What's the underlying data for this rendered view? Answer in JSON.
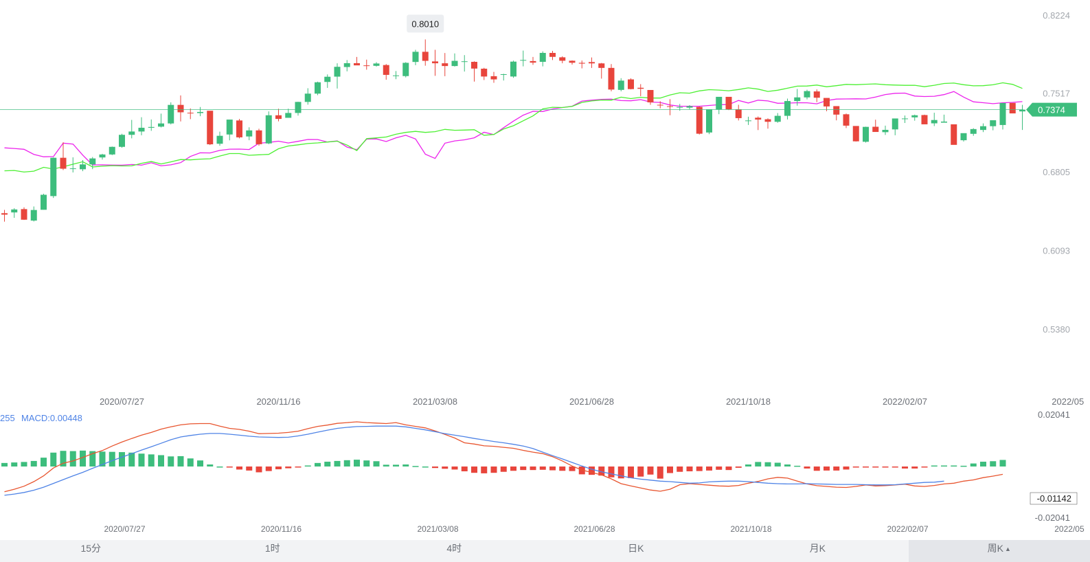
{
  "chart_data": [
    {
      "type": "candlestick",
      "title": "",
      "ylim": [
        0.538,
        0.8224
      ],
      "y_ticks": [
        "0.8224",
        "0.7517",
        "0.6805",
        "0.6093",
        "0.5380"
      ],
      "x_tick_labels": [
        "2020/07/27",
        "2020/11/16",
        "2021/03/08",
        "2021/06/28",
        "2021/10/18",
        "2022/02/07",
        "2022/05"
      ],
      "x_tick_index": [
        12,
        28,
        44,
        60,
        76,
        92,
        107
      ],
      "current_price": "0.7374",
      "max_label": "0.8010",
      "colors": {
        "up": "#3dbd7d",
        "down": "#e8453c",
        "upper_band": "#ec23ec",
        "lower_band": "#4cf032",
        "price_line": "#3dbd7d"
      },
      "candles": [
        [
          0.6436,
          0.6466,
          0.6423,
          0.6359
        ],
        [
          0.6443,
          0.6481,
          0.647,
          0.6394
        ],
        [
          0.6473,
          0.6489,
          0.6377,
          0.6375
        ],
        [
          0.6369,
          0.6497,
          0.6465,
          0.6361
        ],
        [
          0.6467,
          0.6612,
          0.6603,
          0.6468
        ],
        [
          0.6591,
          0.6941,
          0.6938,
          0.6574
        ],
        [
          0.6938,
          0.7078,
          0.6839,
          0.6827
        ],
        [
          0.684,
          0.6942,
          0.6842,
          0.6805
        ],
        [
          0.6834,
          0.6917,
          0.6878,
          0.6817
        ],
        [
          0.6878,
          0.6945,
          0.6932,
          0.6835
        ],
        [
          0.6941,
          0.6974,
          0.6968,
          0.6922
        ],
        [
          0.6968,
          0.704,
          0.7037,
          0.6962
        ],
        [
          0.7037,
          0.7155,
          0.7146,
          0.7029
        ],
        [
          0.7146,
          0.7281,
          0.7176,
          0.7114
        ],
        [
          0.7176,
          0.7305,
          0.721,
          0.7142
        ],
        [
          0.721,
          0.7285,
          0.7217,
          0.7182
        ],
        [
          0.722,
          0.7338,
          0.7249,
          0.7213
        ],
        [
          0.7249,
          0.744,
          0.7417,
          0.724
        ],
        [
          0.7417,
          0.7503,
          0.735,
          0.7267
        ],
        [
          0.7346,
          0.7385,
          0.7343,
          0.7288
        ],
        [
          0.7343,
          0.7398,
          0.7353,
          0.7315
        ],
        [
          0.7364,
          0.7343,
          0.706,
          0.7053
        ],
        [
          0.7065,
          0.7175,
          0.7137,
          0.7047
        ],
        [
          0.7149,
          0.728,
          0.7284,
          0.7096
        ],
        [
          0.7276,
          0.729,
          0.7123,
          0.7114
        ],
        [
          0.7131,
          0.7214,
          0.7186,
          0.7097
        ],
        [
          0.7186,
          0.7201,
          0.7061,
          0.7048
        ],
        [
          0.7068,
          0.7358,
          0.7323,
          0.7061
        ],
        [
          0.7323,
          0.7382,
          0.729,
          0.7268
        ],
        [
          0.73,
          0.7383,
          0.7344,
          0.731
        ],
        [
          0.7344,
          0.7445,
          0.7444,
          0.732
        ],
        [
          0.7444,
          0.7568,
          0.7519,
          0.7419
        ],
        [
          0.7519,
          0.7627,
          0.7622,
          0.7505
        ],
        [
          0.7625,
          0.7693,
          0.7672,
          0.7571
        ],
        [
          0.7673,
          0.7794,
          0.7762,
          0.7565
        ],
        [
          0.776,
          0.7823,
          0.7795,
          0.7721
        ],
        [
          0.7795,
          0.7851,
          0.7775,
          0.7777
        ],
        [
          0.7775,
          0.7827,
          0.7772,
          0.7736
        ],
        [
          0.7771,
          0.7804,
          0.7792,
          0.7764
        ],
        [
          0.7778,
          0.7787,
          0.7689,
          0.7645
        ],
        [
          0.7681,
          0.7724,
          0.7684,
          0.765
        ],
        [
          0.7678,
          0.7804,
          0.7798,
          0.7666
        ],
        [
          0.7806,
          0.7916,
          0.7898,
          0.7777
        ],
        [
          0.7898,
          0.801,
          0.7816,
          0.7772
        ],
        [
          0.7811,
          0.7916,
          0.7794,
          0.768
        ],
        [
          0.7794,
          0.7887,
          0.7769,
          0.7677
        ],
        [
          0.7769,
          0.7883,
          0.7816,
          0.7764
        ],
        [
          0.7809,
          0.7868,
          0.7812,
          0.7719
        ],
        [
          0.7807,
          0.7812,
          0.7746,
          0.7628
        ],
        [
          0.7745,
          0.7753,
          0.7674,
          0.7642
        ],
        [
          0.7677,
          0.7716,
          0.7648,
          0.7617
        ],
        [
          0.7692,
          0.7699,
          0.7695,
          0.7638
        ],
        [
          0.7674,
          0.7818,
          0.7809,
          0.7662
        ],
        [
          0.7818,
          0.7909,
          0.7824,
          0.7766
        ],
        [
          0.7814,
          0.7851,
          0.78,
          0.778
        ],
        [
          0.7807,
          0.7902,
          0.7888,
          0.7766
        ],
        [
          0.7888,
          0.7907,
          0.7852,
          0.7823
        ],
        [
          0.7848,
          0.7857,
          0.7817,
          0.7794
        ],
        [
          0.7817,
          0.782,
          0.7799,
          0.7782
        ],
        [
          0.7798,
          0.7819,
          0.7791,
          0.7748
        ],
        [
          0.7805,
          0.7847,
          0.7793,
          0.7752
        ],
        [
          0.7793,
          0.7797,
          0.7752,
          0.7655
        ],
        [
          0.7752,
          0.7787,
          0.7556,
          0.754
        ],
        [
          0.7553,
          0.7659,
          0.7637,
          0.754
        ],
        [
          0.7648,
          0.7658,
          0.756,
          0.7557
        ],
        [
          0.7572,
          0.7605,
          0.7563,
          0.7496
        ],
        [
          0.7552,
          0.7547,
          0.744,
          0.7418
        ],
        [
          0.7418,
          0.745,
          0.7416,
          0.7386
        ],
        [
          0.7405,
          0.7469,
          0.7402,
          0.7323
        ],
        [
          0.7394,
          0.7426,
          0.7398,
          0.7364
        ],
        [
          0.7392,
          0.7415,
          0.7405,
          0.7378
        ],
        [
          0.7399,
          0.7402,
          0.7156,
          0.7149
        ],
        [
          0.7167,
          0.7372,
          0.7377,
          0.7152
        ],
        [
          0.7376,
          0.7488,
          0.749,
          0.7333
        ],
        [
          0.749,
          0.7472,
          0.7377,
          0.737
        ],
        [
          0.7377,
          0.7418,
          0.7297,
          0.7276
        ],
        [
          0.7272,
          0.731,
          0.7276,
          0.7235
        ],
        [
          0.7301,
          0.7312,
          0.7284,
          0.7189
        ],
        [
          0.7287,
          0.7295,
          0.7264,
          0.7202
        ],
        [
          0.7264,
          0.7343,
          0.7318,
          0.7255
        ],
        [
          0.7318,
          0.7474,
          0.7452,
          0.7285
        ],
        [
          0.7452,
          0.7561,
          0.7485,
          0.741
        ],
        [
          0.7485,
          0.7554,
          0.7542,
          0.7467
        ],
        [
          0.7539,
          0.7557,
          0.7482,
          0.7442
        ],
        [
          0.748,
          0.7479,
          0.7403,
          0.736
        ],
        [
          0.7406,
          0.7398,
          0.7329,
          0.7277
        ],
        [
          0.7332,
          0.7339,
          0.7229,
          0.7207
        ],
        [
          0.7226,
          0.7217,
          0.7087,
          0.7085
        ],
        [
          0.7083,
          0.722,
          0.7218,
          0.7076
        ],
        [
          0.7219,
          0.7283,
          0.7172,
          0.7175
        ],
        [
          0.717,
          0.7229,
          0.7191,
          0.7145
        ],
        [
          0.7195,
          0.7253,
          0.7294,
          0.7142
        ],
        [
          0.7293,
          0.7321,
          0.7294,
          0.7253
        ],
        [
          0.7304,
          0.7329,
          0.7323,
          0.7274
        ],
        [
          0.7325,
          0.7329,
          0.7241,
          0.7246
        ],
        [
          0.725,
          0.7346,
          0.728,
          0.7225
        ],
        [
          0.7256,
          0.7329,
          0.7266,
          0.7257
        ],
        [
          0.7241,
          0.723,
          0.7055,
          0.7069
        ],
        [
          0.7097,
          0.7157,
          0.7161,
          0.7085
        ],
        [
          0.7155,
          0.7206,
          0.7198,
          0.7137
        ],
        [
          0.719,
          0.7249,
          0.7224,
          0.7171
        ],
        [
          0.7224,
          0.7277,
          0.7278,
          0.7187
        ],
        [
          0.7235,
          0.7422,
          0.7434,
          0.7194
        ],
        [
          0.7435,
          0.7372,
          0.734,
          0.7353
        ],
        [
          0.7358,
          0.7417,
          0.7374,
          0.719
        ]
      ],
      "upper_band": [
        0.7028,
        0.7022,
        0.7015,
        0.6969,
        0.6947,
        0.6949,
        0.7071,
        0.7062,
        0.6962,
        0.6873,
        0.6874,
        0.6872,
        0.6871,
        0.6877,
        0.6871,
        0.6893,
        0.6865,
        0.6874,
        0.6894,
        0.695,
        0.6983,
        0.6982,
        0.7005,
        0.7016,
        0.7017,
        0.7013,
        0.707,
        0.7077,
        0.7088,
        0.7072,
        0.7087,
        0.7104,
        0.7103,
        0.7081,
        0.7091,
        0.7035,
        0.7011,
        0.7107,
        0.7109,
        0.7085,
        0.7119,
        0.7142,
        0.7108,
        0.697,
        0.6932,
        0.707,
        0.7091,
        0.7101,
        0.7119,
        0.7169,
        0.7148,
        0.7211,
        0.727,
        0.7324,
        0.7359,
        0.7357,
        0.738,
        0.7393,
        0.7405,
        0.7452,
        0.746,
        0.7467,
        0.7469,
        0.7456,
        0.7454,
        0.7465,
        0.7443,
        0.7439,
        0.7416,
        0.7405,
        0.7405,
        0.7405,
        0.7412,
        0.7419,
        0.742,
        0.7457,
        0.7434,
        0.746,
        0.7453,
        0.7432,
        0.7433,
        0.7437,
        0.7436,
        0.7427,
        0.7456,
        0.747,
        0.7471,
        0.7472,
        0.7471,
        0.7488,
        0.7511,
        0.7522,
        0.7524,
        0.7497,
        0.7493,
        0.7495,
        0.751,
        0.7538,
        0.7488,
        0.7445,
        0.7437,
        0.7428,
        0.7436,
        0.744,
        0.7447
      ],
      "lower_band": [
        0.682,
        0.6823,
        0.6809,
        0.6817,
        0.6852,
        0.6836,
        0.6857,
        0.688,
        0.6902,
        0.6855,
        0.6862,
        0.6867,
        0.6864,
        0.6865,
        0.6888,
        0.6904,
        0.6882,
        0.6901,
        0.6922,
        0.6919,
        0.6926,
        0.6929,
        0.6954,
        0.6976,
        0.6976,
        0.6961,
        0.6965,
        0.6969,
        0.702,
        0.7045,
        0.7055,
        0.7067,
        0.7073,
        0.7081,
        0.7088,
        0.7053,
        0.7003,
        0.7111,
        0.7118,
        0.7126,
        0.7151,
        0.7168,
        0.7177,
        0.7168,
        0.7175,
        0.7195,
        0.7187,
        0.7189,
        0.7192,
        0.7142,
        0.7149,
        0.7199,
        0.7228,
        0.7273,
        0.7317,
        0.7381,
        0.7396,
        0.7393,
        0.7403,
        0.7439,
        0.7453,
        0.7461,
        0.746,
        0.7487,
        0.7474,
        0.7486,
        0.7479,
        0.7479,
        0.7507,
        0.7527,
        0.7523,
        0.7544,
        0.7555,
        0.7551,
        0.7545,
        0.7556,
        0.7571,
        0.756,
        0.7539,
        0.755,
        0.7568,
        0.7587,
        0.7588,
        0.7597,
        0.7581,
        0.7591,
        0.7603,
        0.76,
        0.7604,
        0.7607,
        0.76,
        0.7597,
        0.7594,
        0.7595,
        0.7582,
        0.7595,
        0.7611,
        0.7615,
        0.76,
        0.759,
        0.7591,
        0.7599,
        0.7617,
        0.7603,
        0.7566
      ]
    },
    {
      "type": "macd",
      "legend_prefix": "255",
      "legend_label": "MACD:0.00448",
      "ylim": [
        -0.02041,
        0.02041
      ],
      "y_ticks": [
        "0.02041",
        "-0.01142",
        "-0.02041"
      ],
      "x_tick_labels": [
        "2020/07/27",
        "2020/11/16",
        "2021/03/08",
        "2021/06/28",
        "2021/10/18",
        "2022/02/07",
        "2022/05"
      ],
      "x_tick_index": [
        12,
        28,
        44,
        60,
        76,
        92,
        107
      ],
      "colors": {
        "up": "#3dbd7d",
        "down": "#e8453c",
        "dif": "#e8552f",
        "dea": "#4e83e6"
      },
      "hist": [
        0.0014,
        0.0016,
        0.0018,
        0.0022,
        0.0035,
        0.0055,
        0.0062,
        0.0061,
        0.0063,
        0.0061,
        0.0059,
        0.0058,
        0.0057,
        0.0055,
        0.0051,
        0.0048,
        0.0045,
        0.004,
        0.0041,
        0.0032,
        0.0024,
        0.0008,
        0.0,
        -0.0002,
        -0.0012,
        -0.0016,
        -0.0023,
        -0.0018,
        -0.0011,
        -0.0007,
        -0.0002,
        0.0004,
        0.0014,
        0.0019,
        0.0022,
        0.0025,
        0.0027,
        0.0024,
        0.0021,
        0.0007,
        0.0007,
        0.0008,
        0.0002,
        0.0,
        -0.0006,
        -0.0009,
        -0.0012,
        -0.0019,
        -0.0025,
        -0.0027,
        -0.0025,
        -0.0021,
        -0.0017,
        -0.0014,
        -0.0014,
        -0.0013,
        -0.0015,
        -0.0017,
        -0.0018,
        -0.0031,
        -0.0033,
        -0.0036,
        -0.0043,
        -0.0047,
        -0.0046,
        -0.004,
        -0.0032,
        -0.0048,
        -0.0026,
        -0.0021,
        -0.0019,
        -0.0018,
        -0.0016,
        -0.0013,
        -0.0014,
        -0.0005,
        0.0008,
        0.0018,
        0.0017,
        0.0015,
        0.0008,
        0.0003,
        -0.0008,
        -0.0017,
        -0.0016,
        -0.0016,
        -0.0012,
        -0.0003,
        -0.0003,
        -0.0003,
        -0.0003,
        -0.0003,
        -0.0008,
        -0.0008,
        -0.0004,
        0.0004,
        0.0004,
        0.0004,
        0.0003,
        0.0012,
        0.0019,
        0.0021,
        0.0026
      ],
      "dif": [
        -0.01,
        -0.009,
        -0.0078,
        -0.006,
        -0.0037,
        -0.0006,
        0.0013,
        0.0022,
        0.0036,
        0.0051,
        0.0063,
        0.0081,
        0.0097,
        0.0111,
        0.0124,
        0.0135,
        0.0148,
        0.0157,
        0.0165,
        0.0169,
        0.017,
        0.017,
        0.016,
        0.0151,
        0.0147,
        0.014,
        0.013,
        0.0131,
        0.0132,
        0.0135,
        0.014,
        0.015,
        0.0159,
        0.0164,
        0.0171,
        0.0174,
        0.0177,
        0.0174,
        0.0172,
        0.017,
        0.0174,
        0.0165,
        0.0159,
        0.0153,
        0.0141,
        0.0127,
        0.0113,
        0.0094,
        0.0089,
        0.0082,
        0.008,
        0.0076,
        0.0072,
        0.0064,
        0.0057,
        0.0051,
        0.0039,
        0.0022,
        0.0002,
        -0.0014,
        -0.0024,
        -0.0033,
        -0.0049,
        -0.0068,
        -0.0077,
        -0.0085,
        -0.0093,
        -0.0098,
        -0.009,
        -0.0072,
        -0.0068,
        -0.0071,
        -0.0074,
        -0.0077,
        -0.0078,
        -0.0075,
        -0.0066,
        -0.0059,
        -0.0049,
        -0.0043,
        -0.0046,
        -0.0058,
        -0.0069,
        -0.0076,
        -0.0079,
        -0.0082,
        -0.0083,
        -0.0079,
        -0.0073,
        -0.0077,
        -0.0076,
        -0.0073,
        -0.007,
        -0.0077,
        -0.0079,
        -0.0075,
        -0.0069,
        -0.0066,
        -0.0058,
        -0.0053,
        -0.0044,
        -0.0038,
        -0.0031
      ],
      "dea": [
        -0.0114,
        -0.0109,
        -0.0103,
        -0.0094,
        -0.0082,
        -0.0067,
        -0.0052,
        -0.0037,
        -0.0023,
        -0.0007,
        0.0008,
        0.0023,
        0.0037,
        0.0051,
        0.0065,
        0.0078,
        0.0092,
        0.0106,
        0.0117,
        0.0123,
        0.0128,
        0.0131,
        0.0131,
        0.0128,
        0.0124,
        0.012,
        0.0117,
        0.0116,
        0.0115,
        0.0116,
        0.0121,
        0.0128,
        0.0136,
        0.0144,
        0.0151,
        0.0155,
        0.0158,
        0.0159,
        0.016,
        0.016,
        0.016,
        0.0157,
        0.0151,
        0.0145,
        0.0138,
        0.013,
        0.0124,
        0.0118,
        0.0111,
        0.0105,
        0.0099,
        0.0094,
        0.0088,
        0.0081,
        0.0071,
        0.0057,
        0.0043,
        0.003,
        0.0016,
        0.0002,
        -0.0011,
        -0.0021,
        -0.0029,
        -0.0037,
        -0.0045,
        -0.005,
        -0.0054,
        -0.0058,
        -0.006,
        -0.0063,
        -0.0066,
        -0.0065,
        -0.0061,
        -0.0059,
        -0.0058,
        -0.0058,
        -0.006,
        -0.0063,
        -0.0066,
        -0.0068,
        -0.0069,
        -0.0069,
        -0.0068,
        -0.0069,
        -0.007,
        -0.0071,
        -0.0071,
        -0.0071,
        -0.0072,
        -0.0073,
        -0.0073,
        -0.0072,
        -0.0069,
        -0.0066,
        -0.0063,
        -0.0062,
        -0.0058
      ]
    }
  ],
  "period_tabs": [
    {
      "label": "15分",
      "active": false
    },
    {
      "label": "1时",
      "active": false
    },
    {
      "label": "4时",
      "active": false
    },
    {
      "label": "日K",
      "active": false
    },
    {
      "label": "月K",
      "active": false
    },
    {
      "label": "周K",
      "active": true,
      "caret": "▲"
    }
  ]
}
